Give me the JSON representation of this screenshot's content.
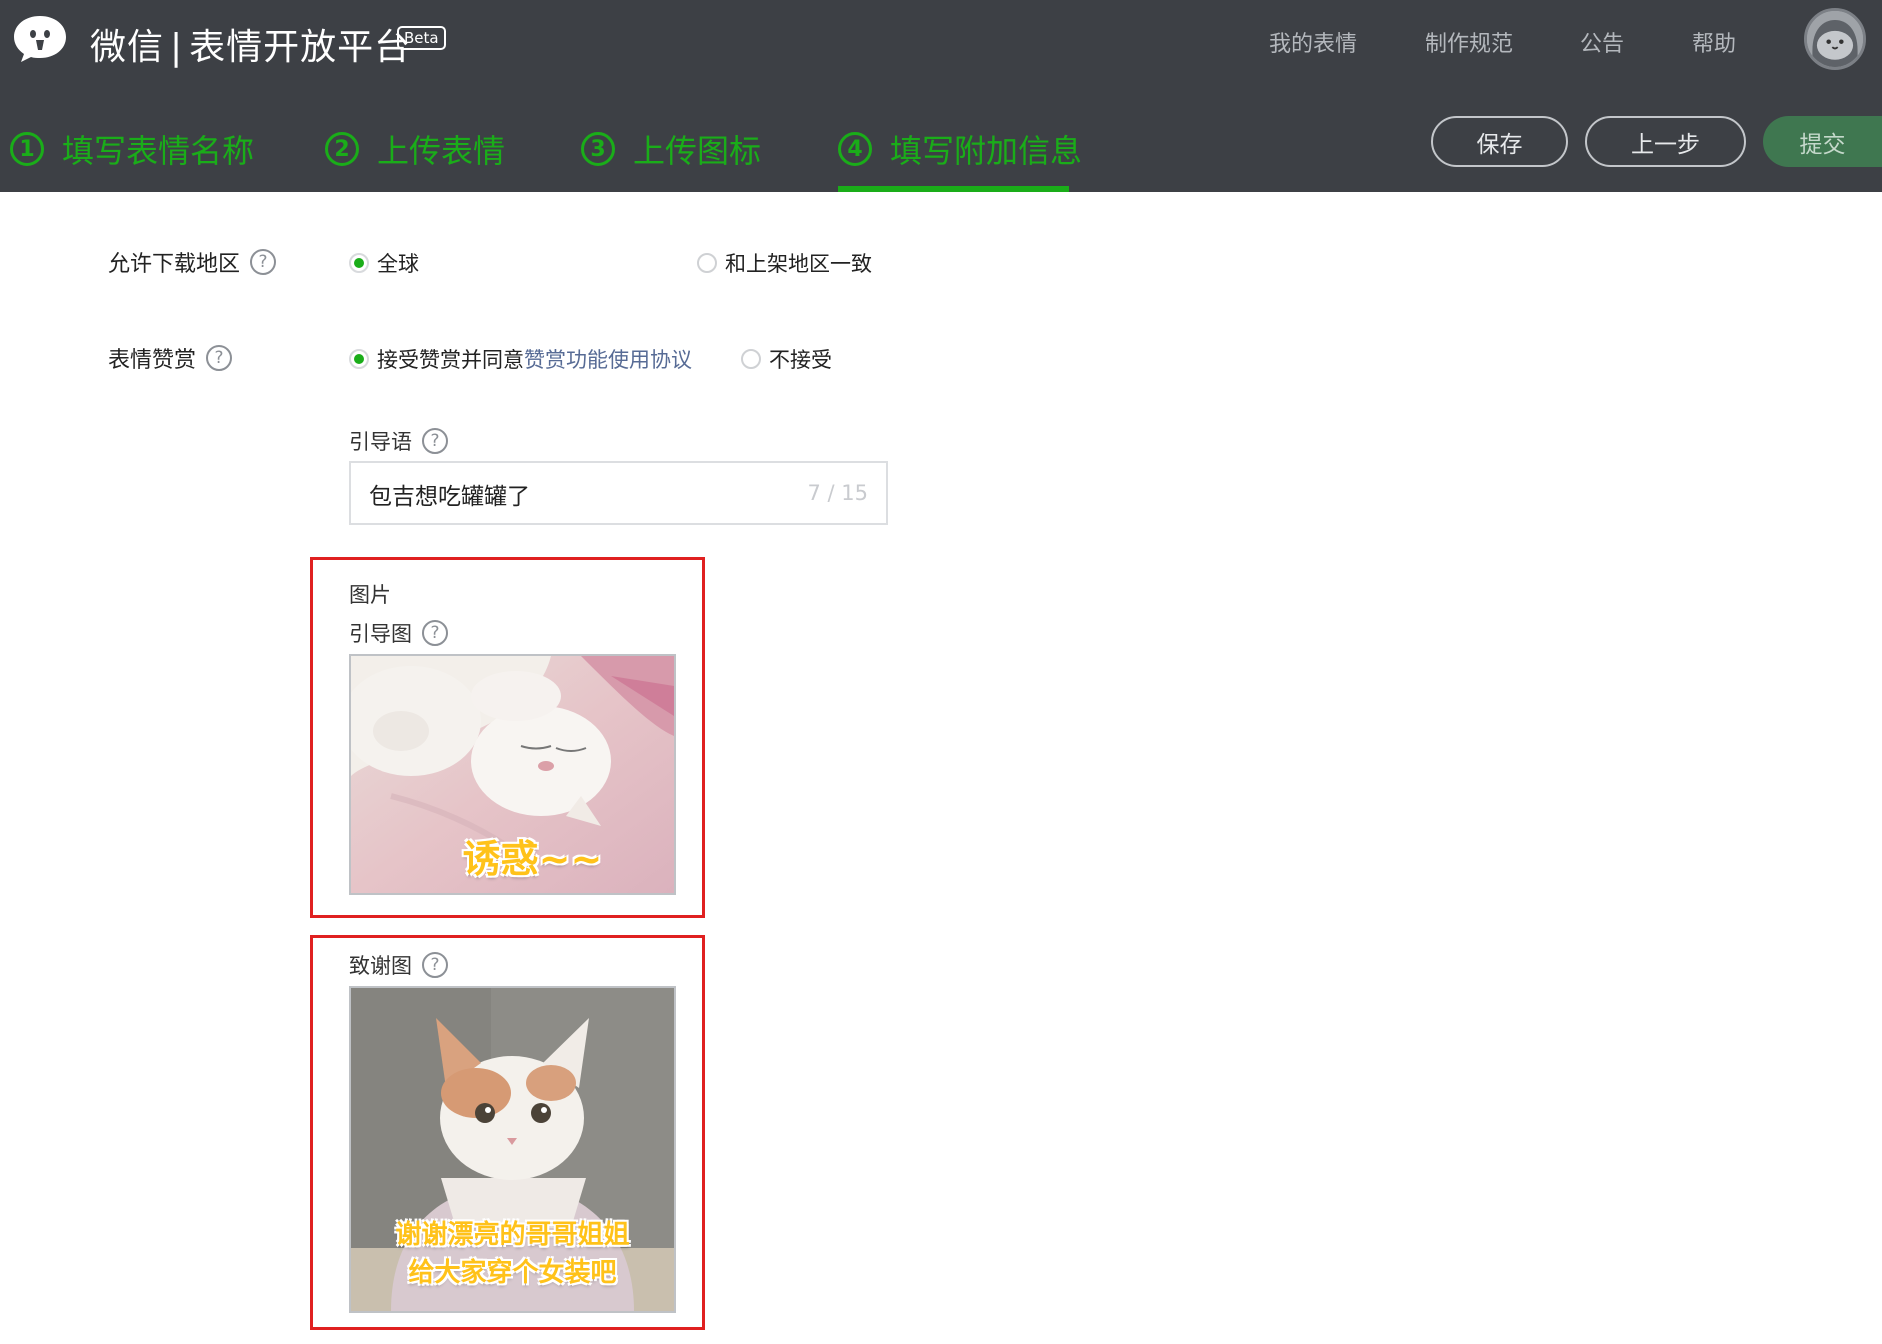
{
  "header": {
    "brand_left": "微信",
    "brand_sep": "|",
    "brand_right": "表情开放平台",
    "beta": "Beta",
    "nav": [
      "我的表情",
      "制作规范",
      "公告",
      "帮助"
    ],
    "steps": [
      {
        "num": "1",
        "label": "填写表情名称"
      },
      {
        "num": "2",
        "label": "上传表情"
      },
      {
        "num": "3",
        "label": "上传图标"
      },
      {
        "num": "4",
        "label": "填写附加信息",
        "active": true
      }
    ],
    "buttons": {
      "save": "保存",
      "prev": "上一步",
      "submit": "提交"
    }
  },
  "form": {
    "region": {
      "label": "允许下载地区",
      "help": "?",
      "options": [
        {
          "label": "全球",
          "selected": true
        },
        {
          "label": "和上架地区一致",
          "selected": false
        }
      ]
    },
    "reward": {
      "label": "表情赞赏",
      "help": "?",
      "accept_prefix": "接受赞赏并同意",
      "accept_link": "赞赏功能使用协议",
      "accept_selected": true,
      "reject": "不接受"
    },
    "guide_text": {
      "label": "引导语",
      "help": "?",
      "value": "包吉想吃罐罐了",
      "count": "7 / 15"
    },
    "images": {
      "section_label": "图片",
      "guide_image": {
        "label": "引导图",
        "help": "?",
        "caption": "诱惑~~"
      },
      "thanks_image": {
        "label": "致谢图",
        "help": "?",
        "caption_line1": "谢谢漂亮的哥哥姐姐",
        "caption_line2": "给大家穿个女装吧"
      }
    }
  },
  "colors": {
    "header_bg": "#3d4045",
    "accent_green": "#1aad19",
    "highlight_red": "#e02020",
    "link_blue": "#576b95"
  }
}
